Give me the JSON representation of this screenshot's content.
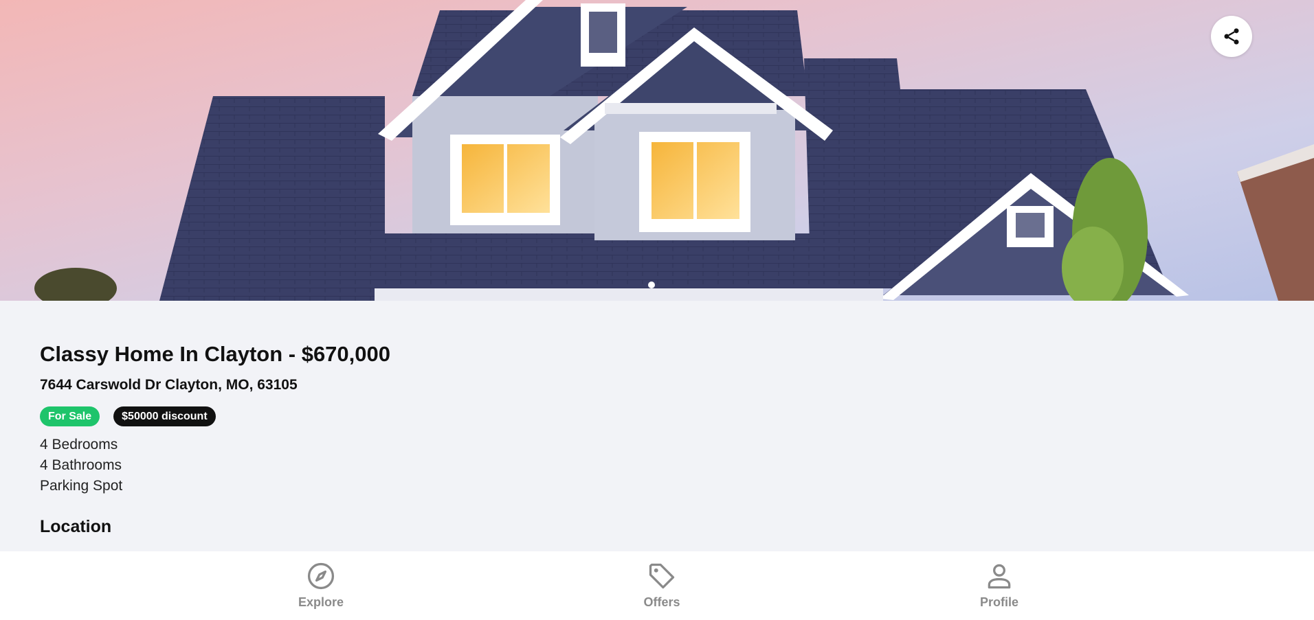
{
  "listing": {
    "title": "Classy Home In Clayton - $670,000",
    "address": "7644 Carswold Dr Clayton, MO, 63105",
    "badges": [
      {
        "label": "For Sale",
        "color": "#1ec46b"
      },
      {
        "label": "$50000 discount",
        "color": "#111111"
      }
    ],
    "features": [
      "4 Bedrooms",
      "4 Bathrooms",
      "Parking Spot"
    ],
    "location_heading": "Location"
  },
  "hero": {
    "image": "house-exterior-dusk-photo",
    "share_icon": "share-icon",
    "carousel_slides": 1,
    "carousel_active": 1
  },
  "nav": {
    "items": [
      {
        "label": "Explore",
        "icon": "compass-icon"
      },
      {
        "label": "Offers",
        "icon": "tag-icon"
      },
      {
        "label": "Profile",
        "icon": "person-icon"
      }
    ]
  },
  "colors": {
    "background": "#f2f3f7",
    "roof": "#3a3f67",
    "siding": "#c3c7d8",
    "nav_icon": "#8a8a8a"
  }
}
